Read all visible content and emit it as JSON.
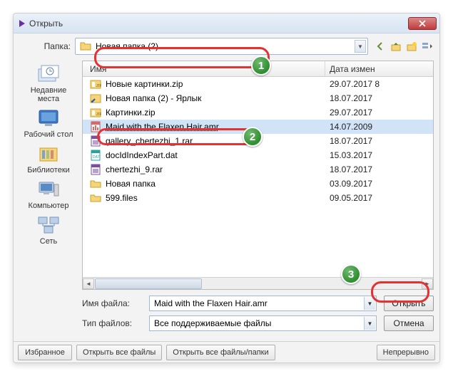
{
  "titlebar": {
    "title": "Открыть"
  },
  "folder_row": {
    "label": "Папка:",
    "value": "Новая папка (2)"
  },
  "places": [
    {
      "key": "recent",
      "label": "Недавние места"
    },
    {
      "key": "desktop",
      "label": "Рабочий стол"
    },
    {
      "key": "libs",
      "label": "Библиотеки"
    },
    {
      "key": "computer",
      "label": "Компьютер"
    },
    {
      "key": "network",
      "label": "Сеть"
    }
  ],
  "columns": {
    "name": "Имя",
    "date": "Дата измен"
  },
  "files": [
    {
      "icon": "zip",
      "name": "Новые картинки.zip",
      "date": "29.07.2017 8",
      "selected": false
    },
    {
      "icon": "link",
      "name": "Новая папка (2) - Ярлык",
      "date": "18.07.2017 ",
      "selected": false
    },
    {
      "icon": "zip",
      "name": "Картинки.zip",
      "date": "29.07.2017 ",
      "selected": false
    },
    {
      "icon": "amr",
      "name": "Maid with the Flaxen Hair.amr",
      "date": "14.07.2009 ",
      "selected": true
    },
    {
      "icon": "rar",
      "name": "gallery_chertezhi_1.rar",
      "date": "18.07.2017 ",
      "selected": false
    },
    {
      "icon": "dat",
      "name": "docIdIndexPart.dat",
      "date": "15.03.2017 ",
      "selected": false
    },
    {
      "icon": "rar",
      "name": "chertezhi_9.rar",
      "date": "18.07.2017 ",
      "selected": false
    },
    {
      "icon": "folder",
      "name": "Новая папка",
      "date": "03.09.2017 ",
      "selected": false
    },
    {
      "icon": "folder",
      "name": "599.files",
      "date": "09.05.2017 ",
      "selected": false
    }
  ],
  "form": {
    "filename_label": "Имя файла:",
    "filename_value": "Maid with the Flaxen Hair.amr",
    "filetype_label": "Тип файлов:",
    "filetype_value": "Все поддерживаемые файлы",
    "open_btn": "Открыть",
    "cancel_btn": "Отмена"
  },
  "bottom": {
    "favorites": "Избранное",
    "open_all_files": "Открыть все файлы",
    "open_all_files_folders": "Открыть все файлы/папки",
    "continuous": "Непрерывно"
  },
  "callouts": {
    "n1": "1",
    "n2": "2",
    "n3": "3"
  }
}
